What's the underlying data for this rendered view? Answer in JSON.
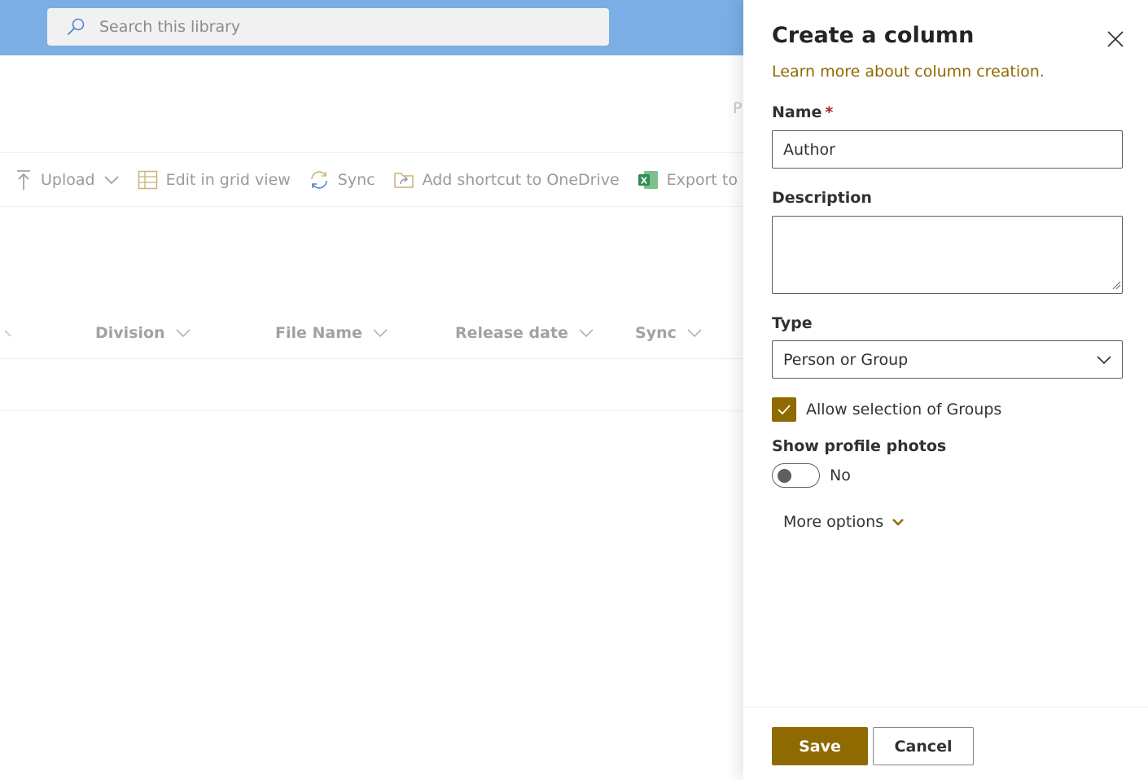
{
  "search": {
    "placeholder": "Search this library"
  },
  "background": {
    "stray_text": "P",
    "command_bar": {
      "upload": "Upload",
      "edit_grid": "Edit in grid view",
      "sync": "Sync",
      "add_shortcut": "Add shortcut to OneDrive",
      "export": "Export to CS"
    },
    "columns": [
      "Division",
      "File Name",
      "Release date",
      "Sync"
    ]
  },
  "panel": {
    "title": "Create a column",
    "learn_more": "Learn more about column creation.",
    "name_label": "Name",
    "required_mark": "*",
    "name_value": "Author",
    "description_label": "Description",
    "description_value": "",
    "type_label": "Type",
    "type_value": "Person or Group",
    "allow_groups_label": "Allow selection of Groups",
    "allow_groups_checked": true,
    "profile_photos_label": "Show profile photos",
    "profile_photos_state": "No",
    "more_options": "More options",
    "save": "Save",
    "cancel": "Cancel"
  },
  "colors": {
    "accent": "#8f6a00",
    "suitebar": "#7aaee4",
    "required": "#a4262c"
  },
  "icons": [
    "search-icon",
    "upload-icon",
    "chevron-down-icon",
    "grid-icon",
    "sync-icon",
    "shortcut-icon",
    "excel-icon",
    "close-icon",
    "checkmark-icon"
  ]
}
